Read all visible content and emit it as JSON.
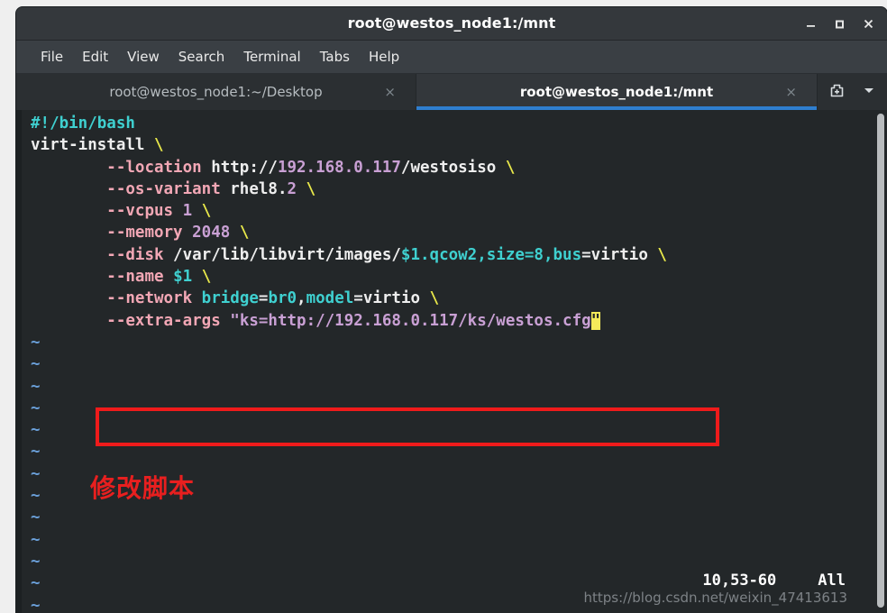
{
  "window": {
    "title": "root@westos_node1:/mnt",
    "controls": {
      "minimize": "minimize-icon",
      "maximize": "maximize-icon",
      "close": "close-icon"
    }
  },
  "menubar": {
    "items": [
      {
        "label": "File"
      },
      {
        "label": "Edit"
      },
      {
        "label": "View"
      },
      {
        "label": "Search"
      },
      {
        "label": "Terminal"
      },
      {
        "label": "Tabs"
      },
      {
        "label": "Help"
      }
    ]
  },
  "tabbar": {
    "tabs": [
      {
        "label": "root@westos_node1:~/Desktop",
        "active": false,
        "close": "×"
      },
      {
        "label": "root@westos_node1:/mnt",
        "active": true,
        "close": "×"
      }
    ],
    "new_tab_icon": "new-tab-icon",
    "dropdown_icon": "chevron-down-icon"
  },
  "editor": {
    "filetype": "bash",
    "lines": [
      {
        "n": 1,
        "text": "#!/bin/bash",
        "tokens": [
          {
            "t": "#!/bin/bash",
            "c": "comment"
          }
        ]
      },
      {
        "n": 2,
        "text": "virt-install \\",
        "tokens": [
          {
            "t": "virt-install ",
            "c": "plain"
          },
          {
            "t": "\\",
            "c": "cont"
          }
        ]
      },
      {
        "n": 3,
        "text": "        --location http://192.168.0.117/westosiso \\",
        "tokens": [
          {
            "t": "        ",
            "c": "plain"
          },
          {
            "t": "--location",
            "c": "opt"
          },
          {
            "t": " http://",
            "c": "plain"
          },
          {
            "t": "192.168.0.117",
            "c": "num"
          },
          {
            "t": "/westosiso ",
            "c": "plain"
          },
          {
            "t": "\\",
            "c": "cont"
          }
        ]
      },
      {
        "n": 4,
        "text": "        --os-variant rhel8.2 \\",
        "tokens": [
          {
            "t": "        ",
            "c": "plain"
          },
          {
            "t": "--os-variant",
            "c": "opt"
          },
          {
            "t": " rhel8.",
            "c": "plain"
          },
          {
            "t": "2",
            "c": "num"
          },
          {
            "t": " ",
            "c": "plain"
          },
          {
            "t": "\\",
            "c": "cont"
          }
        ]
      },
      {
        "n": 5,
        "text": "        --vcpus 1 \\",
        "tokens": [
          {
            "t": "        ",
            "c": "plain"
          },
          {
            "t": "--vcpus",
            "c": "opt"
          },
          {
            "t": " ",
            "c": "plain"
          },
          {
            "t": "1",
            "c": "num"
          },
          {
            "t": " ",
            "c": "plain"
          },
          {
            "t": "\\",
            "c": "cont"
          }
        ]
      },
      {
        "n": 6,
        "text": "        --memory 2048 \\",
        "tokens": [
          {
            "t": "        ",
            "c": "plain"
          },
          {
            "t": "--memory",
            "c": "opt"
          },
          {
            "t": " ",
            "c": "plain"
          },
          {
            "t": "2048",
            "c": "num"
          },
          {
            "t": " ",
            "c": "plain"
          },
          {
            "t": "\\",
            "c": "cont"
          }
        ]
      },
      {
        "n": 7,
        "text": "        --disk /var/lib/libvirt/images/$1.qcow2,size=8,bus=virtio \\",
        "tokens": [
          {
            "t": "        ",
            "c": "plain"
          },
          {
            "t": "--disk",
            "c": "opt"
          },
          {
            "t": " /var/lib/libvirt/images/",
            "c": "plain"
          },
          {
            "t": "$1",
            "c": "ident"
          },
          {
            "t": ".qcow2,size=8,bus",
            "c": "ident"
          },
          {
            "t": "=virtio ",
            "c": "plain"
          },
          {
            "t": "\\",
            "c": "cont"
          }
        ]
      },
      {
        "n": 8,
        "text": "        --name $1 \\",
        "tokens": [
          {
            "t": "        ",
            "c": "plain"
          },
          {
            "t": "--name",
            "c": "opt"
          },
          {
            "t": " ",
            "c": "plain"
          },
          {
            "t": "$1",
            "c": "ident"
          },
          {
            "t": " ",
            "c": "plain"
          },
          {
            "t": "\\",
            "c": "cont"
          }
        ]
      },
      {
        "n": 9,
        "text": "        --network bridge=br0,model=virtio \\",
        "tokens": [
          {
            "t": "        ",
            "c": "plain"
          },
          {
            "t": "--network",
            "c": "opt"
          },
          {
            "t": " ",
            "c": "plain"
          },
          {
            "t": "bridge",
            "c": "ident"
          },
          {
            "t": "=",
            "c": "plain"
          },
          {
            "t": "br0",
            "c": "ident"
          },
          {
            "t": ",",
            "c": "plain"
          },
          {
            "t": "model",
            "c": "ident"
          },
          {
            "t": "=virtio ",
            "c": "plain"
          },
          {
            "t": "\\",
            "c": "cont"
          }
        ]
      },
      {
        "n": 10,
        "text": "        --extra-args \"ks=http://192.168.0.117/ks/westos.cfg\"",
        "tokens": [
          {
            "t": "        ",
            "c": "plain"
          },
          {
            "t": "--extra-args",
            "c": "opt"
          },
          {
            "t": " ",
            "c": "plain"
          },
          {
            "t": "\"ks=http://192.168.0.117/ks/westos.cfg",
            "c": "str"
          },
          {
            "t": "\"",
            "c": "cursor"
          }
        ]
      }
    ],
    "empty_line_marker": "~",
    "empty_line_count": 13
  },
  "annotation": {
    "text": "修改脚本",
    "color": "#e81f1f"
  },
  "highlight_box": {
    "color": "#ef1b1b",
    "targets_line": 10
  },
  "statusline": {
    "position": "10,53-60",
    "scroll": "All"
  },
  "watermark": {
    "text": "https://blog.csdn.net/weixin_47413613"
  },
  "colors": {
    "terminal_bg": "#232729",
    "titlebar_bg": "#34383c",
    "menubar_bg": "#3a3f44",
    "tab_active_underline": "#2f7fd0",
    "comment": "#3fd0d0",
    "option": "#f2a7b5",
    "number": "#c9a0d4",
    "identifier": "#3fd0d0",
    "continuation": "#e8e84a",
    "tilde": "#6a9fd8",
    "cursor": "#f4ea5a"
  }
}
